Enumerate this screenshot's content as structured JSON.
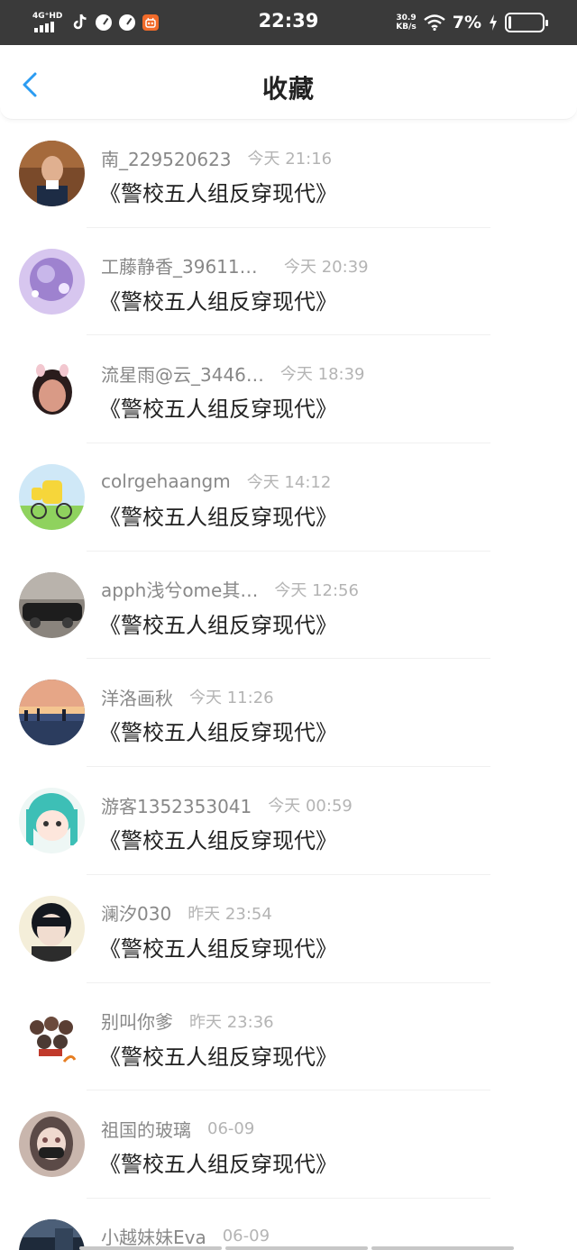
{
  "status_bar": {
    "network": "4G⁺HD",
    "time": "22:39",
    "speed_value": "30.9",
    "speed_unit": "KB/s",
    "battery_pct": "7%",
    "battery_level": 0.07,
    "icons": [
      "signal-icon",
      "tiktok-icon",
      "speed-dial-icon",
      "speed-dial-icon",
      "app-badge-icon",
      "wifi-icon",
      "charging-icon",
      "battery-icon"
    ]
  },
  "header": {
    "title": "收藏",
    "back_icon": "chevron-left-icon",
    "accent_color": "#2b9cf2"
  },
  "items": [
    {
      "username": "南_229520623",
      "time": "今天 21:16",
      "title": "《警校五人组反穿现代》"
    },
    {
      "username": "工藤静香_396113…",
      "time": "今天 20:39",
      "title": "《警校五人组反穿现代》"
    },
    {
      "username": "流星雨@云_3446…",
      "time": "今天 18:39",
      "title": "《警校五人组反穿现代》"
    },
    {
      "username": "colrgehaangm",
      "time": "今天 14:12",
      "title": "《警校五人组反穿现代》"
    },
    {
      "username": "apph浅兮ome其…",
      "time": "今天 12:56",
      "title": "《警校五人组反穿现代》"
    },
    {
      "username": "洋洛画秋",
      "time": "今天 11:26",
      "title": "《警校五人组反穿现代》"
    },
    {
      "username": "游客1352353041",
      "time": "今天 00:59",
      "title": "《警校五人组反穿现代》"
    },
    {
      "username": "澜汐030",
      "time": "昨天 23:54",
      "title": "《警校五人组反穿现代》"
    },
    {
      "username": "别叫你爹",
      "time": "昨天 23:36",
      "title": "《警校五人组反穿现代》"
    },
    {
      "username": "祖国的玻璃",
      "time": "06-09",
      "title": "《警校五人组反穿现代》"
    },
    {
      "username": "小越妹妹Eva",
      "time": "06-09",
      "title": ""
    }
  ]
}
